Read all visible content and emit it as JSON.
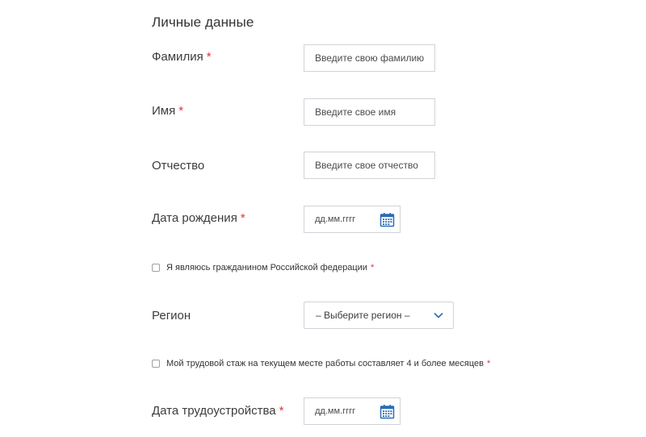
{
  "section": {
    "title": "Личные данные"
  },
  "required_mark": "*",
  "fields": {
    "surname": {
      "label": "Фамилия",
      "placeholder": "Введите свою фамилию"
    },
    "name": {
      "label": "Имя",
      "placeholder": "Введите свое имя"
    },
    "patronymic": {
      "label": "Отчество",
      "placeholder": "Введите свое отчество"
    },
    "birth_date": {
      "label": "Дата рождения",
      "placeholder": "дд.мм.гггг"
    },
    "citizen": {
      "label": "Я являюсь гражданином Российской федерации"
    },
    "region": {
      "label": "Регион",
      "selected": "– Выберите регион –"
    },
    "experience": {
      "label": "Мой трудовой стаж на текущем месте работы составляет 4 и более месяцев"
    },
    "employment_date": {
      "label": "Дата трудоустройства",
      "placeholder": "дд.мм.гггг"
    }
  },
  "icons": {
    "calendar": "calendar-icon",
    "chevron": "chevron-down-icon"
  },
  "colors": {
    "required": "#e0313c",
    "icon_accent": "#2a6cb4",
    "border": "#cfd3d8"
  }
}
